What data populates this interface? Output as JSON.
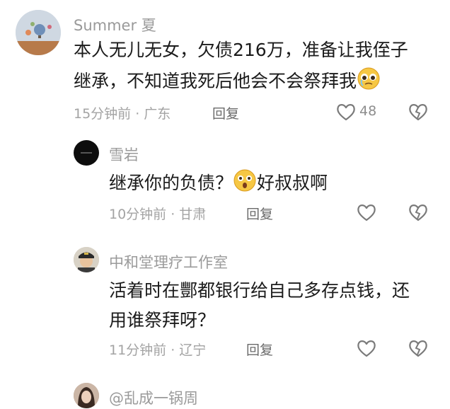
{
  "comments": [
    {
      "username": "Summer 夏",
      "line1": "本人无儿无女，欠债216万，准备让我侄子",
      "line2": "继承，不知道我死后他会不会祭拜我",
      "line2_emoji": "pleading-face-emoji",
      "time": "15分钟前",
      "location": "广东",
      "reply_label": "回复",
      "likes": "48",
      "replies": [
        {
          "username": "雪岩",
          "text_before": "继承你的负债？",
          "emoji": "astonished-face-emoji",
          "text_after": "好叔叔啊",
          "time": "10分钟前",
          "location": "甘肃",
          "reply_label": "回复"
        },
        {
          "username": "中和堂理疗工作室",
          "line1": "活着时在酆都银行给自己多存点钱，还",
          "line2": "用谁祭拜呀？",
          "time": "11分钟前",
          "location": "辽宁",
          "reply_label": "回复"
        },
        {
          "username": "@乱成一锅周"
        }
      ]
    }
  ],
  "separator": "·",
  "icons": {
    "like": "heart-outline-icon",
    "dislike": "broken-heart-icon"
  },
  "colors": {
    "name": "#9a9a9a",
    "text": "#1b1b1b",
    "meta": "#a3a3a3",
    "icon": "#7a7a7a"
  }
}
